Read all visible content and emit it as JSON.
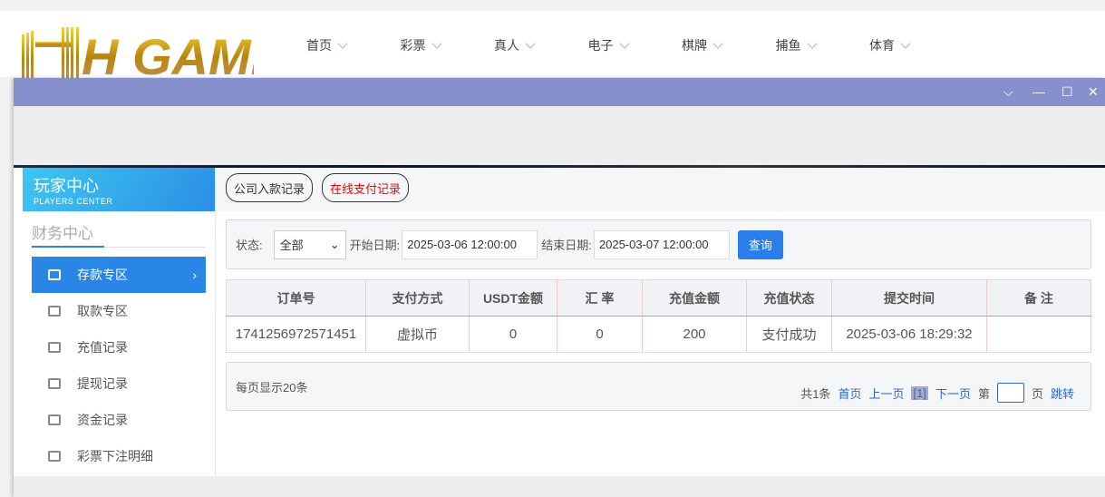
{
  "header": {
    "logo_text": "HH GAME",
    "nav": [
      "首页",
      "彩票",
      "真人",
      "电子",
      "棋牌",
      "捕鱼",
      "体育"
    ]
  },
  "window": {
    "controls": [
      "chevron-down",
      "minimize",
      "maximize",
      "close"
    ]
  },
  "sidebar": {
    "title": "玩家中心",
    "subtitle": "PLAYERS CENTER",
    "section": "财务中心",
    "items": [
      {
        "label": "存款专区",
        "active": true
      },
      {
        "label": "取款专区"
      },
      {
        "label": "充值记录"
      },
      {
        "label": "提现记录"
      },
      {
        "label": "资金记录"
      },
      {
        "label": "彩票下注明细"
      }
    ]
  },
  "tabs": [
    {
      "label": "公司入款记录",
      "color": "#333333"
    },
    {
      "label": "在线支付记录",
      "color": "#ff0000"
    }
  ],
  "filter": {
    "status_label": "状态:",
    "status_value": "全部",
    "start_label": "开始日期:",
    "start_value": "2025-03-06 12:00:00",
    "end_label": "结束日期:",
    "end_value": "2025-03-07 12:00:00",
    "query": "查询"
  },
  "table": {
    "headers": [
      "订单号",
      "支付方式",
      "USDT金额",
      "汇 率",
      "充值金额",
      "充值状态",
      "提交时间",
      "备 注"
    ],
    "rows": [
      [
        "1741256972571451",
        "虚拟币",
        "0",
        "0",
        "200",
        "支付成功",
        "2025-03-06 18:29:32",
        ""
      ]
    ]
  },
  "pager": {
    "per_page": "每页显示20条",
    "total": "共1条",
    "first": "首页",
    "prev": "上一页",
    "current": "[1]",
    "next": "下一页",
    "page_prefix": "第",
    "page_suffix": "页",
    "jump": "跳转"
  },
  "colors": {
    "accent": "#2a86e6",
    "titlebar": "#8690cc"
  }
}
